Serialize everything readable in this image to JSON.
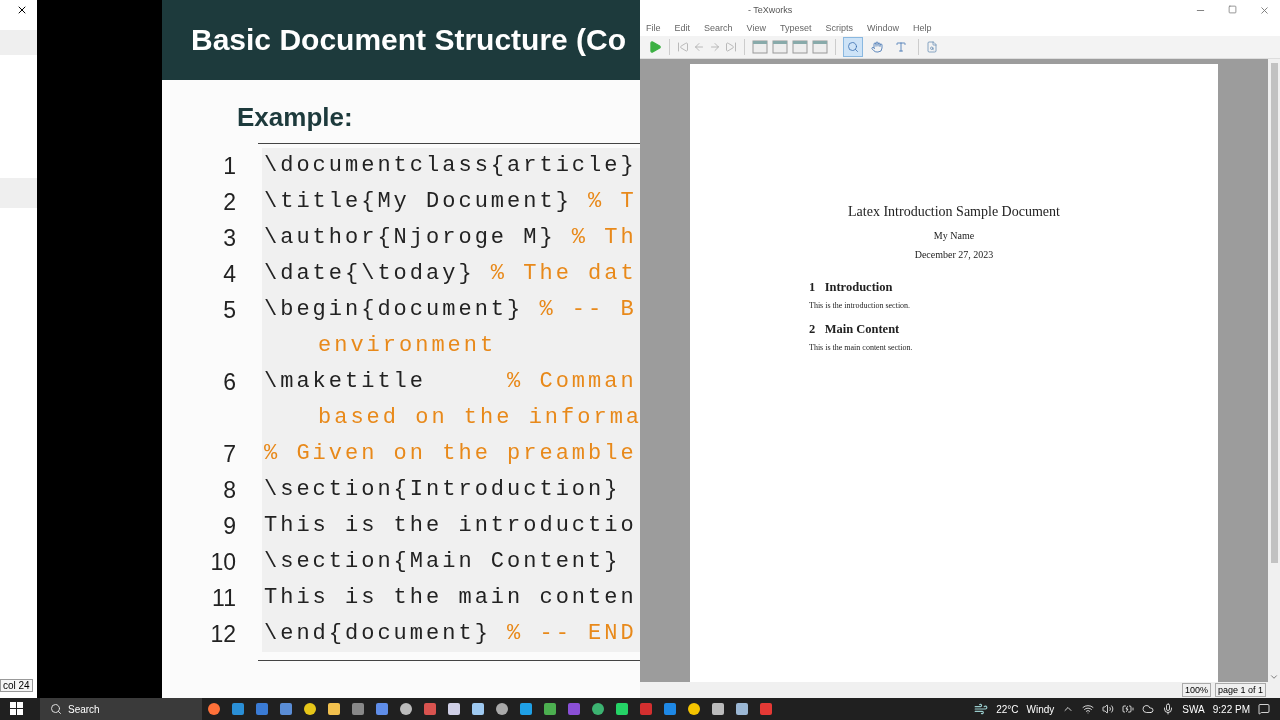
{
  "side_window": {
    "status": "col 24"
  },
  "slide": {
    "title": "Basic Document Structure (Co",
    "heading": "Example:",
    "lines": [
      {
        "number": "1",
        "code": "\\documentclass{article}"
      },
      {
        "number": "2",
        "code": "\\title{My Document} ",
        "comment": "% T"
      },
      {
        "number": "3",
        "code": "\\author{Njoroge M} ",
        "comment": "% Th"
      },
      {
        "number": "4",
        "code": "\\date{\\today} ",
        "comment": "% The dat"
      },
      {
        "number": "5",
        "code": "\\begin{document} ",
        "comment": "% -- B",
        "continuation": "environment"
      },
      {
        "number": "6",
        "code": "\\maketitle     ",
        "comment": "% Comman",
        "continuation": "based on the informa"
      },
      {
        "number": "7",
        "comment": "% Given on the preamble"
      },
      {
        "number": "8",
        "code": "\\section{Introduction}"
      },
      {
        "number": "9",
        "code": "This is the introductio"
      },
      {
        "number": "10",
        "code": "\\section{Main Content}"
      },
      {
        "number": "11",
        "code": "This is the main conten"
      },
      {
        "number": "12",
        "code": "\\end{document} ",
        "comment": "% -- END"
      }
    ]
  },
  "texworks": {
    "title": "- TeXworks",
    "menu": [
      "File",
      "Edit",
      "Search",
      "View",
      "Typeset",
      "Scripts",
      "Window",
      "Help"
    ],
    "mouse_tools": [
      {
        "selected": true
      },
      {
        "selected": false
      },
      {
        "selected": false
      }
    ],
    "document": {
      "title": "Latex Introduction Sample Document",
      "author": "My Name",
      "date": "December 27, 2023",
      "sections": [
        {
          "number": "1",
          "heading": "Introduction",
          "body": "This is the introduction section."
        },
        {
          "number": "2",
          "heading": "Main Content",
          "body": "This is the main content section."
        }
      ]
    },
    "status": {
      "zoom": "100%",
      "page": "page 1 of 1"
    }
  },
  "taskbar": {
    "search_placeholder": "Search",
    "weather": "22°C",
    "condition": "Windy",
    "language": "SWA",
    "time": "9:22 PM"
  }
}
